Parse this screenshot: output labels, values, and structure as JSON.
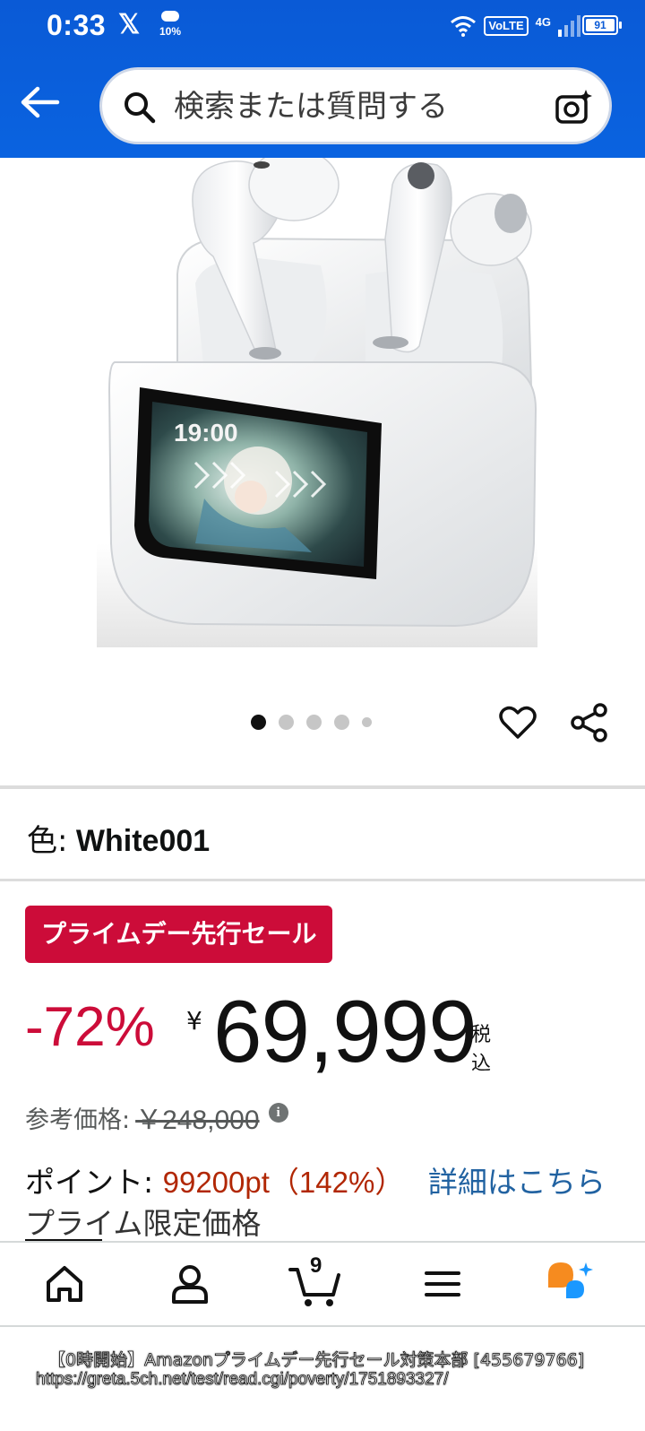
{
  "status_bar": {
    "time": "0:33",
    "x_app": "𝕏",
    "weather_percent": "10%",
    "volte": "VoLTE",
    "network": "4G",
    "battery": "91"
  },
  "search": {
    "placeholder": "検索または質問する"
  },
  "product_image": {
    "screen_time": "19:00"
  },
  "carousel": {
    "count": 5,
    "active_index": 0
  },
  "variant": {
    "label": "色:",
    "value": "White001"
  },
  "deal": {
    "badge": "プライムデー先行セール"
  },
  "price": {
    "discount": "-72%",
    "currency": "¥",
    "amount": "69,999",
    "tax_note": "税込"
  },
  "reference": {
    "label": "参考価格:",
    "price": "￥248,000",
    "info_icon": "i"
  },
  "points": {
    "label": "ポイント:",
    "value": "99200pt（142%）",
    "link": "詳細はこちら"
  },
  "prime_price_label": "プライム限定価格",
  "bottom_nav": {
    "cart_count": "9"
  },
  "caption": {
    "line1": "【0時開始】Amazonプライムデー先行セール対策本部 [455679766]",
    "line2": "https://greta.5ch.net/test/read.cgi/poverty/1751893327/"
  },
  "colors": {
    "header_blue": "#0a5ad6",
    "deal_red": "#cc0c39",
    "points_red": "#b12704",
    "link_blue": "#2162a1",
    "rufus_orange": "#f68b1f",
    "rufus_blue": "#1a98ff"
  },
  "icons": [
    "back-arrow-icon",
    "search-icon",
    "camera-icon",
    "heart-icon",
    "share-icon",
    "home-icon",
    "account-icon",
    "cart-icon",
    "menu-icon",
    "rufus-icon",
    "info-icon"
  ]
}
